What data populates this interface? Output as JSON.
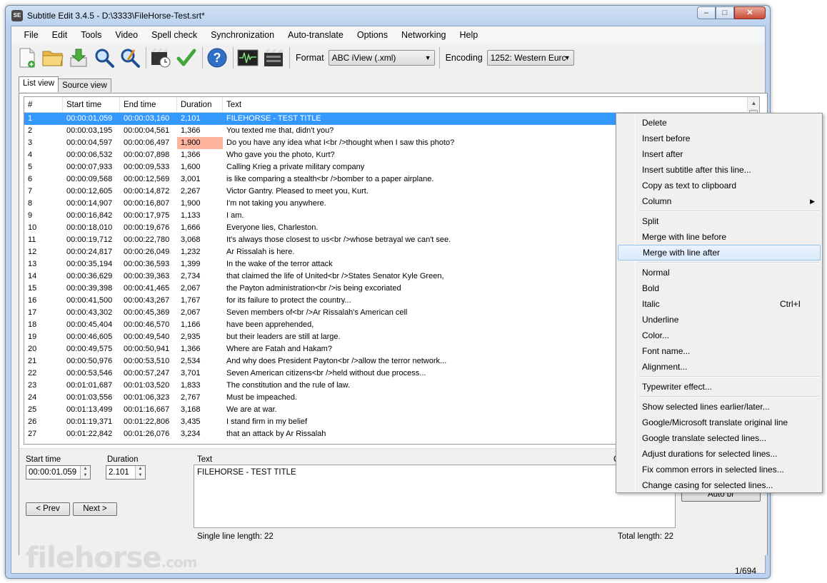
{
  "window": {
    "title": "Subtitle Edit 3.4.5 - D:\\3333\\FileHorse-Test.srt*",
    "app_icon_text": "SE"
  },
  "menu": [
    "File",
    "Edit",
    "Tools",
    "Video",
    "Spell check",
    "Synchronization",
    "Auto-translate",
    "Options",
    "Networking",
    "Help"
  ],
  "toolbar": {
    "icons": [
      "new-file-icon",
      "open-folder-icon",
      "save-icon",
      "find-icon",
      "replace-icon",
      "visual-sync-icon",
      "spell-check-icon",
      "help-icon",
      "waveform-icon",
      "video-icon"
    ],
    "format_label": "Format",
    "format_value": "ABC iView (.xml)",
    "encoding_label": "Encoding",
    "encoding_value": "1252: Western Eurc"
  },
  "tabs": [
    "List view",
    "Source view"
  ],
  "grid": {
    "columns": [
      "#",
      "Start time",
      "End time",
      "Duration",
      "Text"
    ],
    "selected_index": 0,
    "warn_row_index": 2,
    "rows": [
      [
        "1",
        "00:00:01,059",
        "00:00:03,160",
        "2,101",
        "FILEHORSE - TEST TITLE"
      ],
      [
        "2",
        "00:00:03,195",
        "00:00:04,561",
        "1,366",
        "You texted me that, didn't you?"
      ],
      [
        "3",
        "00:00:04,597",
        "00:00:06,497",
        "1,900",
        "Do you have any idea what I<br />thought when I saw this photo?"
      ],
      [
        "4",
        "00:00:06,532",
        "00:00:07,898",
        "1,366",
        "Who gave you the photo, Kurt?"
      ],
      [
        "5",
        "00:00:07,933",
        "00:00:09,533",
        "1,600",
        "Calling Krieg a private military company"
      ],
      [
        "6",
        "00:00:09,568",
        "00:00:12,569",
        "3,001",
        "is like comparing a stealth<br />bomber to a paper airplane."
      ],
      [
        "7",
        "00:00:12,605",
        "00:00:14,872",
        "2,267",
        "Victor Gantry. Pleased to meet you, Kurt."
      ],
      [
        "8",
        "00:00:14,907",
        "00:00:16,807",
        "1,900",
        "I'm not taking you anywhere."
      ],
      [
        "9",
        "00:00:16,842",
        "00:00:17,975",
        "1,133",
        "I am."
      ],
      [
        "10",
        "00:00:18,010",
        "00:00:19,676",
        "1,666",
        "Everyone lies, Charleston."
      ],
      [
        "11",
        "00:00:19,712",
        "00:00:22,780",
        "3,068",
        "It's always those closest to us<br />whose betrayal we can't see."
      ],
      [
        "12",
        "00:00:24,817",
        "00:00:26,049",
        "1,232",
        "Ar Rissalah is here."
      ],
      [
        "13",
        "00:00:35,194",
        "00:00:36,593",
        "1,399",
        "In the wake of the terror attack"
      ],
      [
        "14",
        "00:00:36,629",
        "00:00:39,363",
        "2,734",
        "that claimed the life of United<br />States Senator Kyle Green,"
      ],
      [
        "15",
        "00:00:39,398",
        "00:00:41,465",
        "2,067",
        "the Payton administration<br />is being excoriated"
      ],
      [
        "16",
        "00:00:41,500",
        "00:00:43,267",
        "1,767",
        "for its failure to protect the country..."
      ],
      [
        "17",
        "00:00:43,302",
        "00:00:45,369",
        "2,067",
        "Seven members of<br />Ar Rissalah's American cell"
      ],
      [
        "18",
        "00:00:45,404",
        "00:00:46,570",
        "1,166",
        "have been apprehended,"
      ],
      [
        "19",
        "00:00:46,605",
        "00:00:49,540",
        "2,935",
        "but their leaders are still at large."
      ],
      [
        "20",
        "00:00:49,575",
        "00:00:50,941",
        "1,366",
        "Where are Fatah and Hakam?"
      ],
      [
        "21",
        "00:00:50,976",
        "00:00:53,510",
        "2,534",
        "And why does President Payton<br />allow the terror network..."
      ],
      [
        "22",
        "00:00:53,546",
        "00:00:57,247",
        "3,701",
        "Seven American citizens<br />held without due process..."
      ],
      [
        "23",
        "00:01:01,687",
        "00:01:03,520",
        "1,833",
        "The constitution and the rule of law."
      ],
      [
        "24",
        "00:01:03,556",
        "00:01:06,323",
        "2,767",
        "Must be impeached."
      ],
      [
        "25",
        "00:01:13,499",
        "00:01:16,667",
        "3,168",
        "We are at war."
      ],
      [
        "26",
        "00:01:19,371",
        "00:01:22,806",
        "3,435",
        "I stand firm in my belief"
      ],
      [
        "27",
        "00:01:22,842",
        "00:01:26,076",
        "3,234",
        "that an attack by Ar Rissalah"
      ]
    ]
  },
  "editor": {
    "start_time_label": "Start time",
    "start_time_value": "00:00:01.059",
    "duration_label": "Duration",
    "duration_value": "2.101",
    "text_label": "Text",
    "text_value": "FILEHORSE - TEST TITLE",
    "chars_label_partial": "Ch",
    "prev_label": "< Prev",
    "next_label": "Next >",
    "auto_br_partial": "Auto br",
    "single_line_length": "Single line length: 22",
    "total_length": "Total length: 22"
  },
  "watermark": {
    "brand": "filehorse",
    "suffix": ".com"
  },
  "status": {
    "position": "1/694"
  },
  "context_menu": {
    "highlighted_index": 8,
    "groups": [
      [
        {
          "label": "Delete"
        },
        {
          "label": "Insert before"
        },
        {
          "label": "Insert after"
        },
        {
          "label": "Insert subtitle after this line..."
        },
        {
          "label": "Copy as text to clipboard"
        },
        {
          "label": "Column",
          "submenu": "▶"
        }
      ],
      [
        {
          "label": "Split"
        },
        {
          "label": "Merge with line before"
        },
        {
          "label": "Merge with line after"
        }
      ],
      [
        {
          "label": "Normal"
        },
        {
          "label": "Bold"
        },
        {
          "label": "Italic",
          "shortcut": "Ctrl+I"
        },
        {
          "label": "Underline"
        },
        {
          "label": "Color..."
        },
        {
          "label": "Font name..."
        },
        {
          "label": "Alignment..."
        }
      ],
      [
        {
          "label": "Typewriter effect..."
        }
      ],
      [
        {
          "label": "Show selected lines earlier/later..."
        },
        {
          "label": "Google/Microsoft translate original line"
        },
        {
          "label": "Google translate selected lines..."
        },
        {
          "label": "Adjust durations for selected lines..."
        },
        {
          "label": "Fix common errors in selected lines..."
        },
        {
          "label": "Change casing for selected lines..."
        }
      ]
    ]
  },
  "colors": {
    "selection": "#3399ff",
    "warning_cell": "#ffb4a0",
    "menu_highlight": "#d9ebfc"
  }
}
